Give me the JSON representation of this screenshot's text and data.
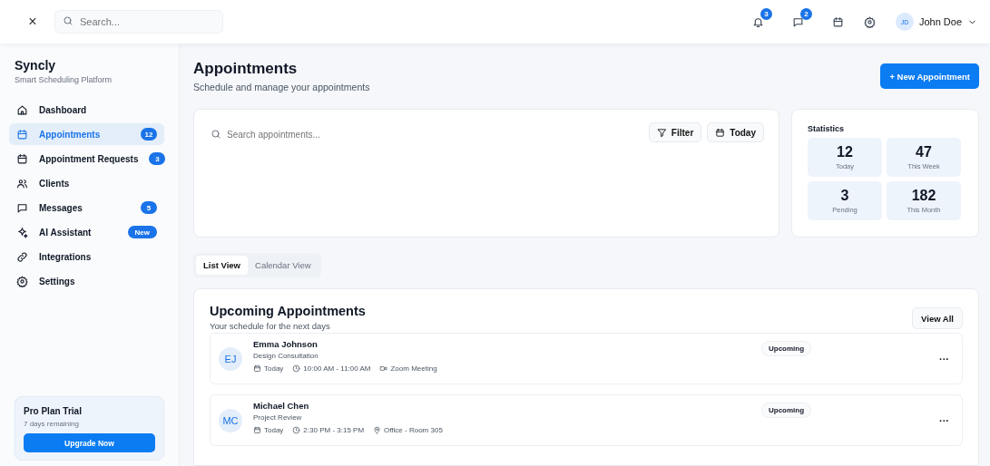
{
  "topbar": {
    "close": "×",
    "search": {
      "placeholder": "Search..."
    },
    "notifications": "3",
    "messages": "2",
    "user": {
      "initials": "JD",
      "name": "John Doe"
    }
  },
  "sidebar": {
    "brand": "Syncly",
    "tagline": "Smart Scheduling Platform",
    "items": [
      {
        "label": "Dashboard",
        "selected": false
      },
      {
        "label": "Appointments",
        "selected": true,
        "badge": "12"
      },
      {
        "label": "Appointment Requests",
        "selected": false,
        "badge": "3"
      },
      {
        "label": "Clients",
        "selected": false
      },
      {
        "label": "Messages",
        "selected": false,
        "badge": "5"
      },
      {
        "label": "AI Assistant",
        "selected": false,
        "badge": "New"
      },
      {
        "label": "Integrations",
        "selected": false
      },
      {
        "label": "Settings",
        "selected": false
      }
    ],
    "trial": {
      "title": "Pro Plan Trial",
      "subtitle": "7 days remaining",
      "button": "Upgrade Now"
    }
  },
  "header": {
    "title": "Appointments",
    "subtitle": "Schedule and manage your appointments",
    "new_button": "+ New Appointment"
  },
  "search_panel": {
    "placeholder": "Search appointments...",
    "filter_button": "Filter",
    "today_button": "Today"
  },
  "statistics": {
    "title": "Statistics",
    "tiles": [
      {
        "value": "12",
        "label": "Today"
      },
      {
        "value": "47",
        "label": "This Week"
      },
      {
        "value": "3",
        "label": "Pending"
      },
      {
        "value": "182",
        "label": "This Month"
      }
    ]
  },
  "view_tabs": [
    {
      "label": "List View",
      "selected": true
    },
    {
      "label": "Calendar View",
      "selected": false
    }
  ],
  "upcoming": {
    "title": "Upcoming Appointments",
    "subtitle": "Your schedule for the next days",
    "view_all": "View All",
    "appointments": [
      {
        "initials": "EJ",
        "name": "Emma Johnson",
        "type": "Design Consultation",
        "status": "Upcoming",
        "more": "···",
        "meta": [
          {
            "kind": "date",
            "text": "Today"
          },
          {
            "kind": "time",
            "text": "10:00 AM - 11:00 AM"
          },
          {
            "kind": "video",
            "text": "Zoom Meeting"
          }
        ]
      },
      {
        "initials": "MC",
        "name": "Michael Chen",
        "type": "Project Review",
        "status": "Upcoming",
        "more": "···",
        "meta": [
          {
            "kind": "date",
            "text": "Today"
          },
          {
            "kind": "time",
            "text": "2:30 PM - 3:15 PM"
          },
          {
            "kind": "location",
            "text": "Office - Room 305"
          }
        ]
      }
    ]
  }
}
